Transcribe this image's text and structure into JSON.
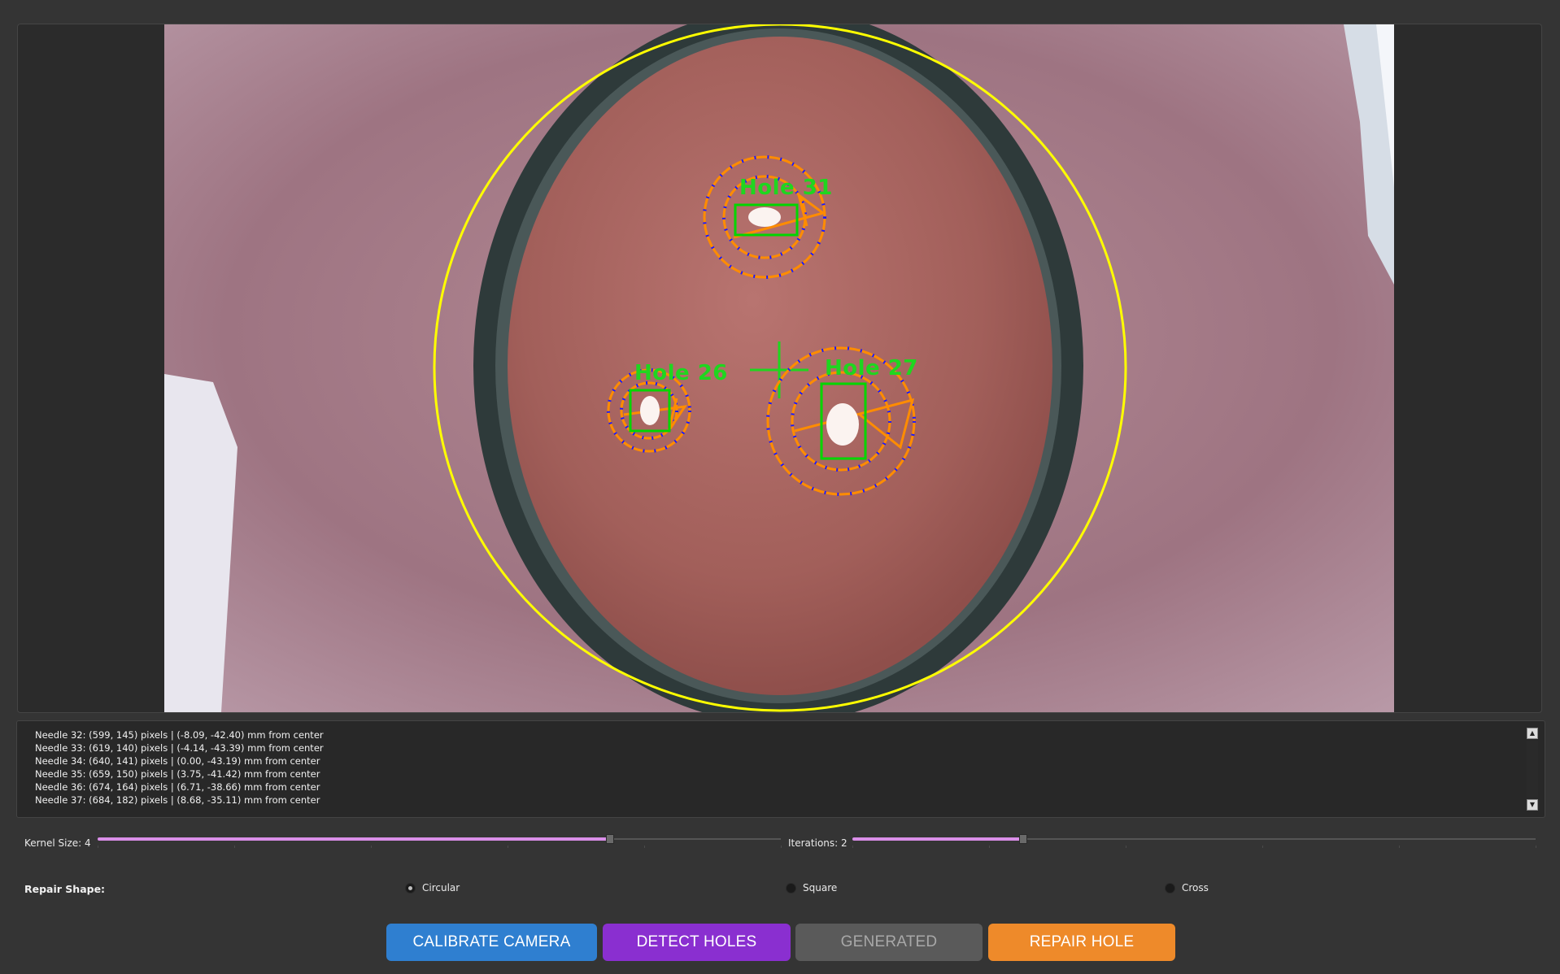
{
  "video": {
    "holes": [
      {
        "label": "Hole 31"
      },
      {
        "label": "Hole 26"
      },
      {
        "label": "Hole 27"
      }
    ],
    "colors": {
      "boundary_circle": "#ffff00",
      "label": "#1fd61f",
      "bounding_box": "#00d600",
      "repair_path": "#ff8c00",
      "needle_points": "#1a1aff"
    }
  },
  "log": {
    "lines": [
      "Needle 32: (599, 145) pixels | (-8.09, -42.40) mm from center",
      "Needle 33: (619, 140) pixels | (-4.14, -43.39) mm from center",
      "Needle 34: (640, 141) pixels | (0.00, -43.19) mm from center",
      "Needle 35: (659, 150) pixels | (3.75, -41.42) mm from center",
      "Needle 36: (674, 164) pixels | (6.71, -38.66) mm from center",
      "Needle 37: (684, 182) pixels | (8.68, -35.11) mm from center"
    ],
    "scroll_up_icon": "up-arrow",
    "scroll_down_icon": "down-arrow"
  },
  "sliders": {
    "kernel": {
      "label": "Kernel Size: 4",
      "fraction": 0.75
    },
    "iterations": {
      "label": "Iterations: 2",
      "fraction": 0.25
    }
  },
  "repair_shape": {
    "label": "Repair Shape:",
    "options": [
      {
        "label": "Circular",
        "selected": true
      },
      {
        "label": "Square",
        "selected": false
      },
      {
        "label": "Cross",
        "selected": false
      }
    ]
  },
  "buttons": {
    "calibrate": {
      "label": "CALIBRATE CAMERA",
      "color": "#2f7fd0"
    },
    "detect": {
      "label": "DETECT HOLES",
      "color": "#8a2fd0"
    },
    "generated": {
      "label": "GENERATED",
      "color": "#5a5a5a"
    },
    "repair": {
      "label": "REPAIR HOLE",
      "color": "#ee8a2a"
    }
  }
}
